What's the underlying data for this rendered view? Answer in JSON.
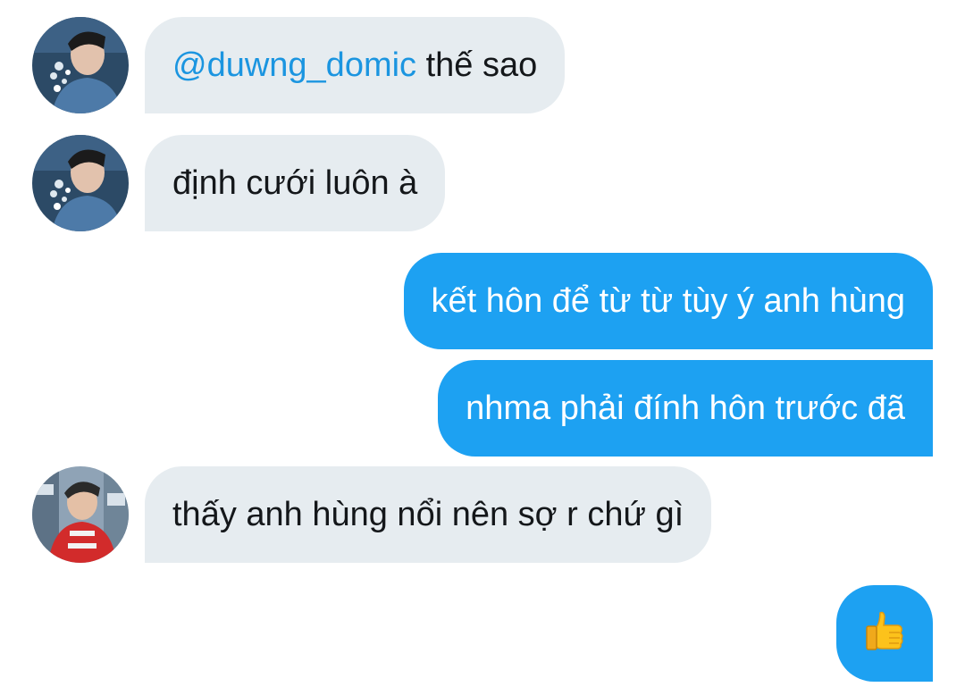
{
  "messages": [
    {
      "direction": "incoming",
      "sender": "duwng_domic",
      "mention": "@duwng_domic",
      "text": " thế sao"
    },
    {
      "direction": "incoming",
      "sender": "duwng_domic",
      "text": "định cưới luôn à"
    },
    {
      "direction": "outgoing",
      "text": "kết hôn để từ từ tùy ý anh hùng"
    },
    {
      "direction": "outgoing",
      "text": "nhma phải đính hôn trước đã"
    },
    {
      "direction": "incoming",
      "sender": "other_user",
      "text": "thấy anh hùng nổi nên sợ r chứ gì"
    },
    {
      "direction": "outgoing",
      "emoji": "thumbs-up"
    }
  ],
  "colors": {
    "incoming_bubble": "#e6ecf0",
    "outgoing_bubble": "#1da1f2",
    "mention": "#1b95e0",
    "text_dark": "#14171a"
  }
}
